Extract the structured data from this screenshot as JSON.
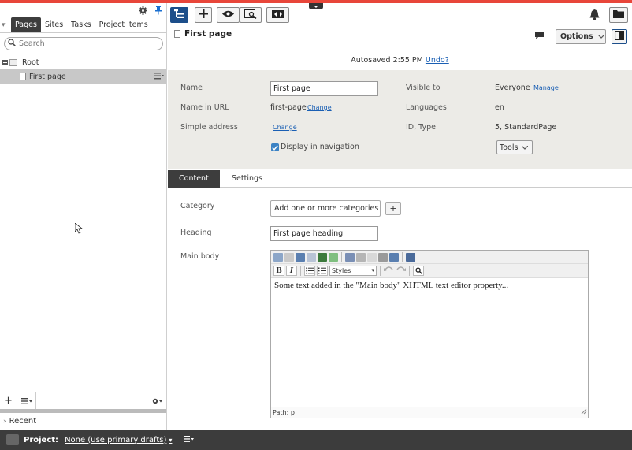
{
  "left_panel": {
    "tabs": [
      "Pages",
      "Sites",
      "Tasks",
      "Project Items"
    ],
    "active_tab": "Pages",
    "search_placeholder": "Search",
    "tree": {
      "root": "Root",
      "selected_page": "First page"
    },
    "recent_label": "Recent"
  },
  "bottom_bar": {
    "project_label": "Project:",
    "project_value": "None (use primary drafts)"
  },
  "page_header": {
    "title": "First page",
    "options_label": "Options",
    "autosave_text": "Autosaved 2:55 PM",
    "undo_label": "Undo?"
  },
  "properties": {
    "name_label": "Name",
    "name_value": "First page",
    "url_label": "Name in URL",
    "url_value": "first-page",
    "change_label": "Change",
    "simple_label": "Simple address",
    "display_in_nav": "Display in navigation",
    "visible_label": "Visible to",
    "visible_value": "Everyone",
    "manage_label": "Manage",
    "languages_label": "Languages",
    "languages_value": "en",
    "idtype_label": "ID, Type",
    "idtype_value": "5, StandardPage",
    "tools_label": "Tools"
  },
  "content_tabs": [
    "Content",
    "Settings"
  ],
  "content": {
    "category_label": "Category",
    "category_placeholder": "Add one or more categories",
    "heading_label": "Heading",
    "heading_value": "First page heading",
    "mainbody_label": "Main body",
    "styles_label": "Styles",
    "body_text": "Some text added in the \"Main body\" XHTML text editor property...",
    "path_text": "Path: p"
  },
  "colors": {
    "top_accent": "#e8463a",
    "primary_blue": "#1c4e8a",
    "dark_bar": "#3c3c3c",
    "props_bg": "#ecebe7"
  }
}
